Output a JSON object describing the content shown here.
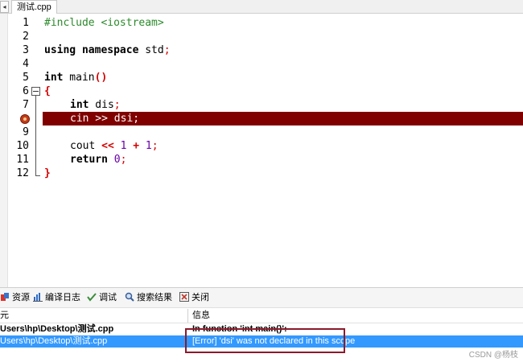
{
  "tabs": {
    "scroll_glyph": "◂",
    "active_file": "测试.cpp"
  },
  "editor": {
    "lines": [
      {
        "num": "1"
      },
      {
        "num": "2"
      },
      {
        "num": "3"
      },
      {
        "num": "4"
      },
      {
        "num": "5"
      },
      {
        "num": "6"
      },
      {
        "num": "7"
      },
      {
        "num": "8"
      },
      {
        "num": "9"
      },
      {
        "num": "10"
      },
      {
        "num": "11"
      },
      {
        "num": "12"
      }
    ],
    "code": {
      "l1_pre": "#include <iostream>",
      "l3_kw": "using namespace",
      "l3_id": " std",
      "l3_semi": ";",
      "l5_kw": "int",
      "l5_id": " main",
      "l5_paren": "()",
      "l6_brace": "{",
      "l7_kw": "int",
      "l7_id": " dis",
      "l7_semi": ";",
      "l8_text": "cin >> dsi;",
      "l10_id": "cout ",
      "l10_op": "<<",
      "l10_num1": " 1",
      "l10_plus": " +",
      "l10_num2": " 1",
      "l10_semi": ";",
      "l11_kw": "return",
      "l11_num": " 0",
      "l11_semi": ";",
      "l12_brace": "}"
    },
    "colors": {
      "error_line": "#800000",
      "breakpoint": "#c23b16"
    }
  },
  "panel": {
    "tabs": [
      {
        "label": "资源",
        "icon": "resource-icon"
      },
      {
        "label": "编译日志",
        "icon": "chart-icon"
      },
      {
        "label": "调试",
        "icon": "check-icon"
      },
      {
        "label": "搜索结果",
        "icon": "search-icon"
      },
      {
        "label": "关闭",
        "icon": "close-icon"
      }
    ],
    "columns": {
      "unit": "元",
      "message": "信息"
    },
    "rows": [
      {
        "unit": "Users\\hp\\Desktop\\测试.cpp",
        "message": "In function 'int main()':"
      },
      {
        "unit": "Users\\hp\\Desktop\\测试.cpp",
        "message": "[Error] 'dsi' was not declared in this scope"
      }
    ],
    "colors": {
      "selected_row": "#3399ff",
      "highlight_box": "#8b1a2b"
    }
  },
  "watermark": "CSDN @杨枝"
}
